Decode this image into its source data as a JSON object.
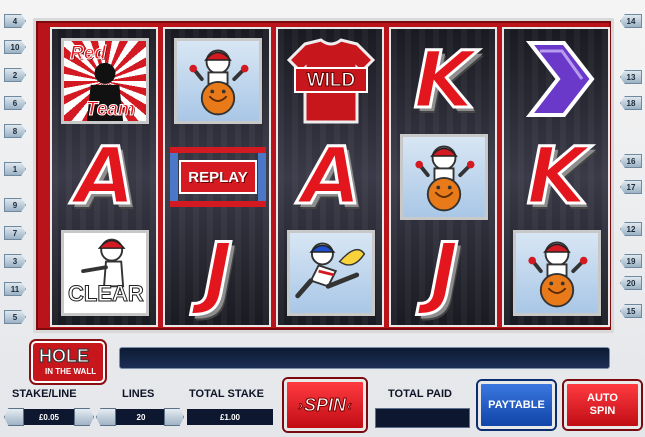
{
  "reels": [
    {
      "symbols": [
        {
          "kind": "redteam",
          "top_text": "Red",
          "bottom_text": "Team"
        },
        {
          "kind": "letter",
          "text": "A"
        },
        {
          "kind": "clear",
          "text": "CLEAR"
        }
      ]
    },
    {
      "symbols": [
        {
          "kind": "player-ball"
        },
        {
          "kind": "replay",
          "text": "REPLAY"
        },
        {
          "kind": "letter",
          "text": "J"
        }
      ]
    },
    {
      "symbols": [
        {
          "kind": "wild",
          "text": "WILD"
        },
        {
          "kind": "letter",
          "text": "A"
        },
        {
          "kind": "player-kick"
        }
      ]
    },
    {
      "symbols": [
        {
          "kind": "letter",
          "text": "K"
        },
        {
          "kind": "player-ball"
        },
        {
          "kind": "letter",
          "text": "J"
        }
      ]
    },
    {
      "symbols": [
        {
          "kind": "chevron"
        },
        {
          "kind": "letter",
          "text": "K"
        },
        {
          "kind": "player-ball"
        }
      ]
    }
  ],
  "line_markers": {
    "left": [
      "4",
      "10",
      "2",
      "6",
      "8",
      "1",
      "9",
      "7",
      "3",
      "11",
      "5"
    ],
    "right": [
      "14",
      "13",
      "18",
      "16",
      "17",
      "12",
      "19",
      "20",
      "15"
    ]
  },
  "logo": {
    "top": "HOLE",
    "bottom": "IN THE WALL"
  },
  "controls": {
    "stake_label": "STAKE/LINE",
    "stake_value": "£0.05",
    "lines_label": "LINES",
    "lines_value": "20",
    "total_stake_label": "TOTAL STAKE",
    "total_stake_value": "£1.00",
    "spin_label": "SPIN",
    "total_paid_label": "TOTAL PAID",
    "total_paid_value": "",
    "paytable_label": "PAYTABLE",
    "autospin_line1": "AUTO",
    "autospin_line2": "SPIN"
  },
  "colors": {
    "frame_red": "#b8141a",
    "letter_red": "#e3161e",
    "button_blue": "#1f5bc8",
    "panel_navy": "#0d1730"
  }
}
